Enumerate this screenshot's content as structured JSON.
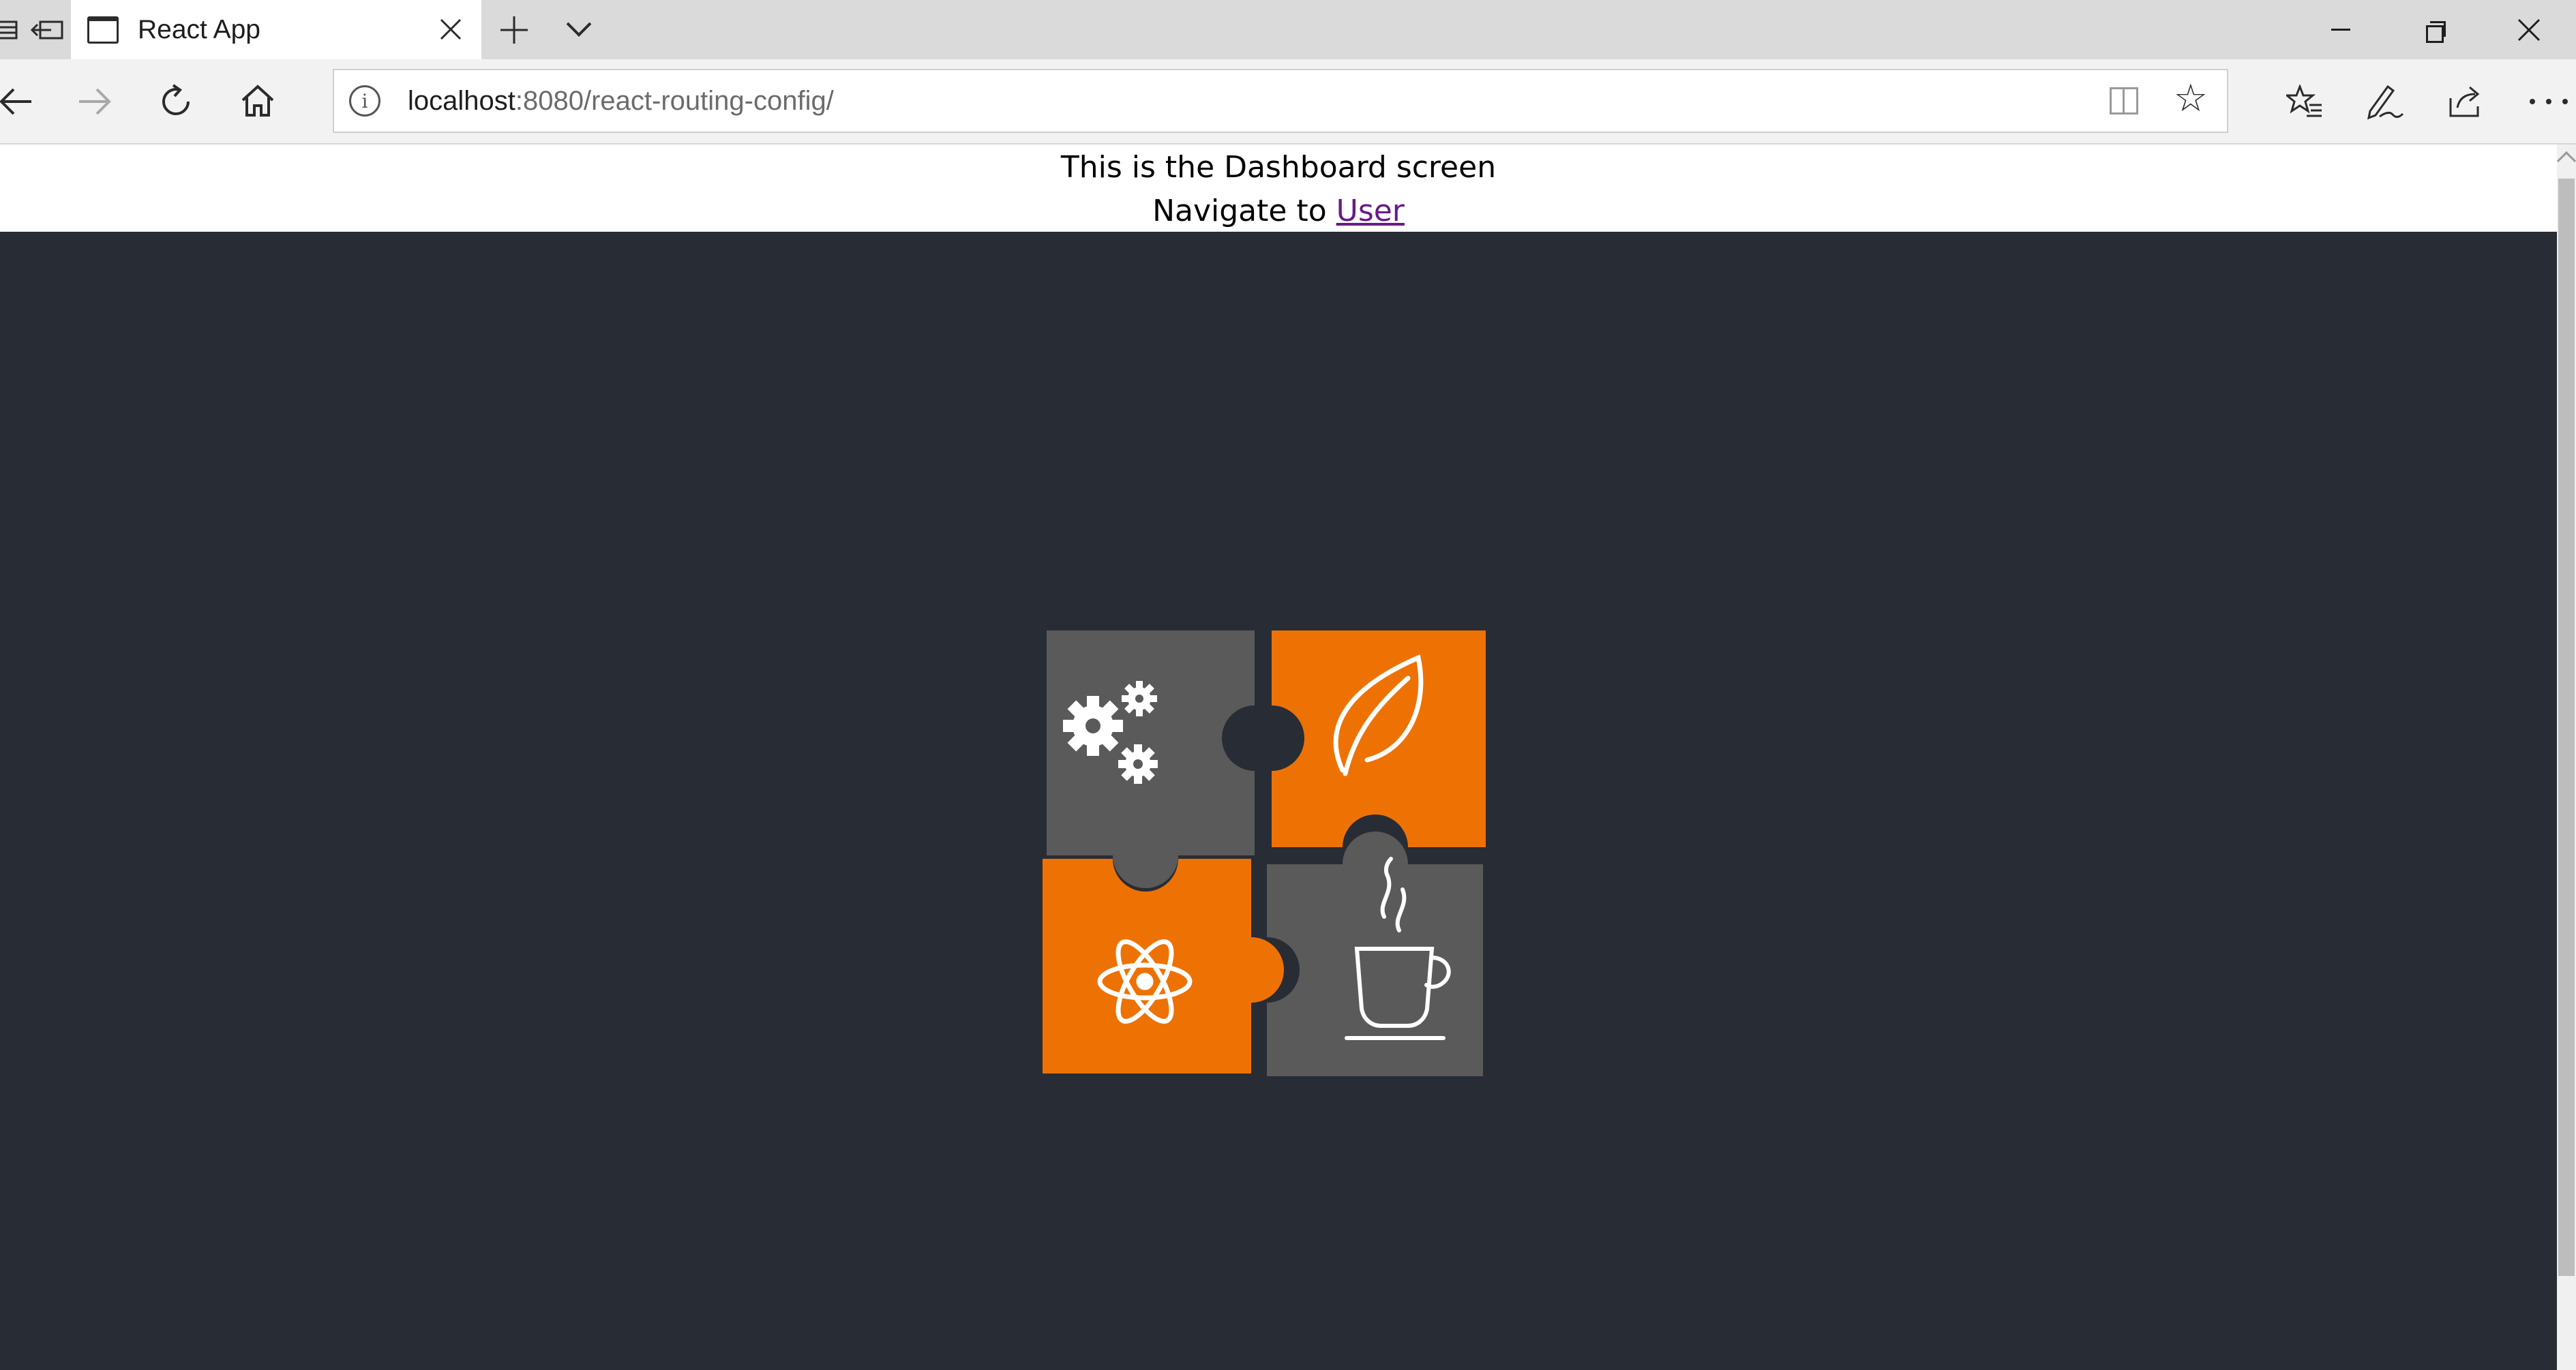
{
  "browser": {
    "tab": {
      "title": "React App"
    },
    "address": {
      "host": "localhost",
      "path": ":8080/react-routing-config/"
    }
  },
  "page": {
    "heading": "This is the Dashboard screen",
    "navigate_prefix": "Navigate to",
    "navigate_link": "User"
  },
  "colors": {
    "app_background": "#282c34",
    "puzzle_orange": "#ee7203",
    "puzzle_gray": "#5a5a5a",
    "link_visited": "#681a87"
  },
  "logo_icons": [
    "gears-icon",
    "leaf-icon",
    "atom-icon",
    "coffee-cup-icon"
  ]
}
